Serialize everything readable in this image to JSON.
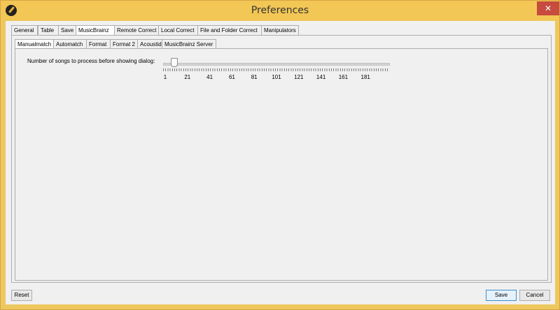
{
  "window": {
    "title": "Preferences"
  },
  "tabs": [
    {
      "label": "General"
    },
    {
      "label": "Table"
    },
    {
      "label": "Save"
    },
    {
      "label": "MusicBrainz"
    },
    {
      "label": "Remote Correct"
    },
    {
      "label": "Local Correct"
    },
    {
      "label": "File and Folder Correct"
    },
    {
      "label": "Manipulators"
    }
  ],
  "subtabs": [
    {
      "label": "Manualmatch"
    },
    {
      "label": "Automatch"
    },
    {
      "label": "Format"
    },
    {
      "label": "Format 2"
    },
    {
      "label": "Acoustid"
    },
    {
      "label": "MusicBrainz Server"
    }
  ],
  "manualmatch": {
    "label": "Number of songs to process before showing dialog:",
    "slider": {
      "min": 1,
      "max": 201,
      "value": 11
    },
    "tick_labels": [
      "1",
      "21",
      "41",
      "61",
      "81",
      "101",
      "121",
      "141",
      "161",
      "181"
    ]
  },
  "buttons": {
    "reset": "Reset",
    "save": "Save",
    "cancel": "Cancel"
  },
  "colors": {
    "titlebar": "#f3c755",
    "close": "#c74b3e",
    "panel": "#f0f0f0"
  },
  "icons": {
    "app": "app-icon",
    "close": "close-icon"
  }
}
